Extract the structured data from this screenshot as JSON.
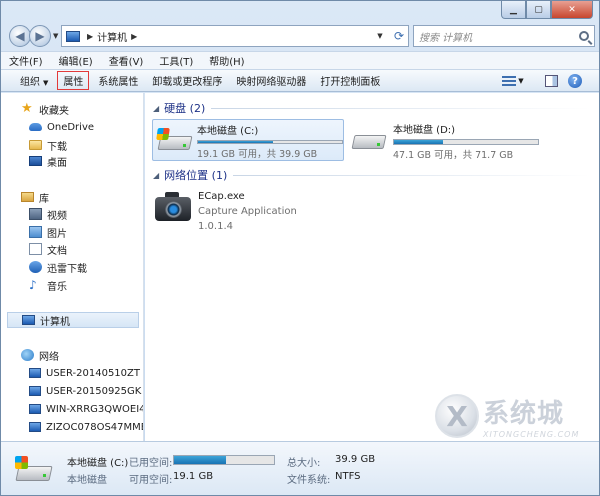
{
  "address": {
    "location": "计算机"
  },
  "search": {
    "placeholder": "搜索 计算机"
  },
  "menu": [
    "文件(F)",
    "编辑(E)",
    "查看(V)",
    "工具(T)",
    "帮助(H)"
  ],
  "toolbar": {
    "organize": "组织",
    "properties": "属性",
    "system_properties": "系统属性",
    "uninstall": "卸载或更改程序",
    "map_drive": "映射网络驱动器",
    "control_panel": "打开控制面板"
  },
  "nav": {
    "favorites": "收藏夹",
    "onedrive": "OneDrive",
    "downloads": "下载",
    "desktop": "桌面",
    "libraries": "库",
    "videos": "视频",
    "pictures": "图片",
    "documents": "文档",
    "xunlei": "迅雷下载",
    "music": "音乐",
    "computer": "计算机",
    "network": "网络",
    "hosts": [
      "USER-20140510ZT",
      "USER-20150925GK",
      "WIN-XRRG3QWOEI4",
      "ZIZOC078OS47MME"
    ]
  },
  "groups": {
    "hard_disks": "硬盘 (2)",
    "network_locations": "网络位置 (1)"
  },
  "drives": [
    {
      "name": "本地磁盘 (C:)",
      "size_text": "19.1 GB 可用，共 39.9 GB",
      "used_fraction": 0.52
    },
    {
      "name": "本地磁盘 (D:)",
      "size_text": "47.1 GB 可用，共 71.7 GB",
      "used_fraction": 0.34
    }
  ],
  "network_app": {
    "name": "ECap.exe",
    "description": "Capture Application",
    "version": "1.0.1.4"
  },
  "watermark": {
    "title": "系统城",
    "subtitle": "XITONGCHENG.COM"
  },
  "details": {
    "name": "本地磁盘 (C:)",
    "type": "本地磁盘",
    "used_label": "已用空间:",
    "free_label": "可用空间:",
    "free_value": "19.1 GB",
    "total_label": "总大小:",
    "total_value": "39.9 GB",
    "fs_label": "文件系统:",
    "fs_value": "NTFS",
    "used_fraction": 0.52
  }
}
